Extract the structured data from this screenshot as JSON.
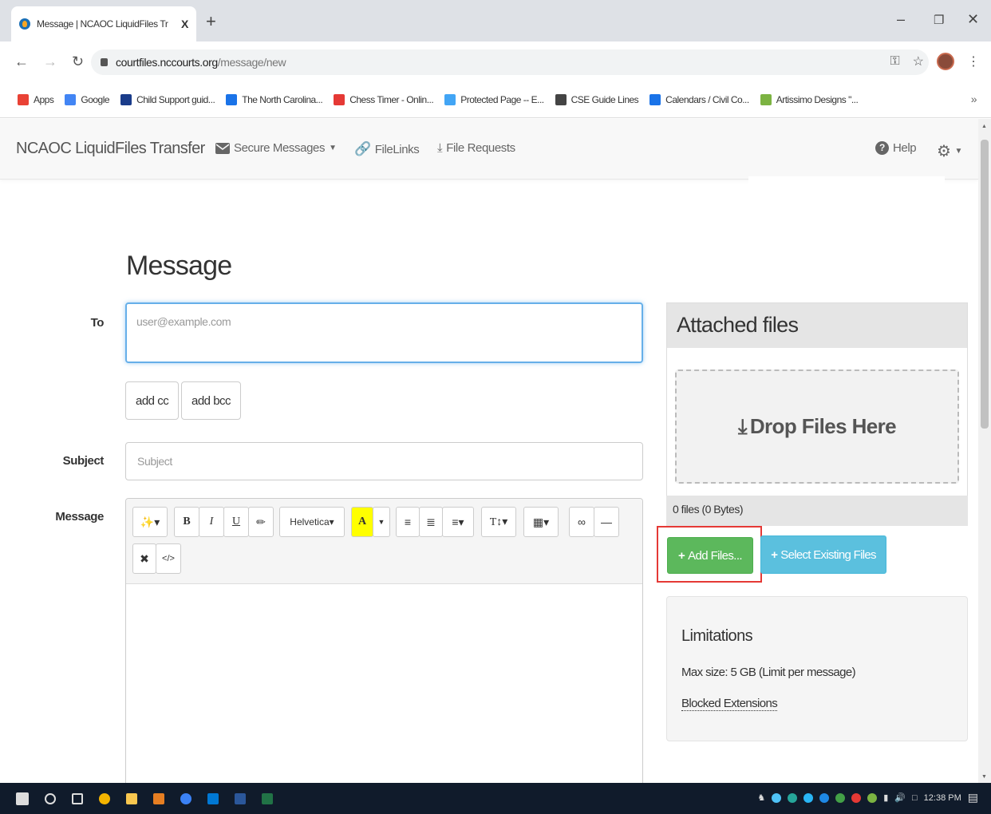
{
  "browser": {
    "tab_title": "Message | NCAOC LiquidFiles Tr",
    "tab_close": "X",
    "new_tab": "+",
    "url_host": "courtfiles.nccourts.org",
    "url_path": "/message/new",
    "bookmarks": [
      {
        "label": "Apps",
        "icon": "apps-grid-icon",
        "color": "#e94235"
      },
      {
        "label": "Google",
        "icon": "google-icon",
        "color": "#4285f4"
      },
      {
        "label": "Child Support guid...",
        "icon": "nc-icon",
        "color": "#1a3c8a"
      },
      {
        "label": "The North Carolina...",
        "icon": "circle-icon",
        "color": "#1a73e8"
      },
      {
        "label": "Chess Timer - Onlin...",
        "icon": "chess-icon",
        "color": "#e53935"
      },
      {
        "label": "Protected Page -- E...",
        "icon": "page-icon",
        "color": "#42a5f5"
      },
      {
        "label": "CSE Guide Lines",
        "icon": "globe-icon",
        "color": "#444444"
      },
      {
        "label": "Calendars / Civil Co...",
        "icon": "circle-icon",
        "color": "#1a73e8"
      },
      {
        "label": "Artissimo Designs \"...",
        "icon": "h-icon",
        "color": "#7cb342"
      }
    ]
  },
  "navbar": {
    "brand": "NCAOC LiquidFiles Transfer",
    "secure_messages": "Secure Messages",
    "filelinks": "FileLinks",
    "file_requests": "File Requests",
    "help": "Help"
  },
  "form": {
    "title": "Message",
    "to_label": "To",
    "to_placeholder": "user@example.com",
    "add_cc": "add cc",
    "add_bcc": "add bcc",
    "subject_label": "Subject",
    "subject_placeholder": "Subject",
    "message_label": "Message",
    "font_name": "Helvetica"
  },
  "attachments": {
    "title": "Attached files",
    "drop_text": "Drop Files Here",
    "count": "0 files (0 Bytes)",
    "add_files": "Add Files...",
    "select_existing": "Select Existing Files"
  },
  "limitations": {
    "title": "Limitations",
    "max_size": "Max size: 5 GB (Limit per message)",
    "blocked": "Blocked Extensions"
  },
  "taskbar": {
    "time": "12:38 PM"
  },
  "colors": {
    "success": "#5cb85c",
    "info": "#5bc0de",
    "highlight": "#e53935",
    "focus": "#66afe9"
  }
}
